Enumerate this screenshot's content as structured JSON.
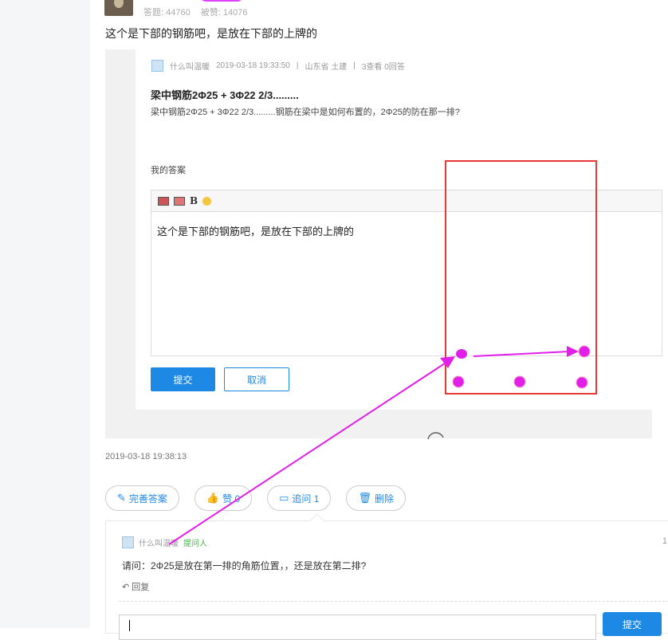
{
  "post": {
    "stats": {
      "answers": "答题: 44760",
      "likes": "被赞: 14076"
    },
    "answer_text": "这个是下部的钢筋吧，是放在下部的上牌的"
  },
  "screenshot": {
    "meta": {
      "user": "什么叫温暖",
      "datetime": "2019-03-18 19:33:50",
      "sep1": "|",
      "location": "山东省 土建",
      "sep2": "|",
      "views": "3查看 0回答"
    },
    "question_title": "梁中钢筋2Φ25 + 3Φ22 2/3.........",
    "question_desc": "梁中钢筋2Φ25 + 3Φ22  2/3.........钢筋在梁中是如何布置的，2Φ25的防在那一排?",
    "my_answer_label": "我的答案",
    "toolbar": {
      "bold": "B"
    },
    "editor_text": "这个是下部的钢筋吧，是放在下部的上牌的",
    "submit_label": "提交",
    "cancel_label": "取消"
  },
  "timestamp": "2019-03-18 19:38:13",
  "actions": {
    "improve": "完善答案",
    "like": "赞 0",
    "followup": "追问 1",
    "delete": "删除"
  },
  "followup": {
    "user": "什么叫温暖",
    "role": "提问人",
    "count": "1",
    "question": "请问：2Φ25是放在第一排的角筋位置，，还是放在第二排?",
    "reply_label": "回复",
    "submit_label": "提交"
  },
  "colors": {
    "accent": "#1e88e5",
    "annotation_magenta": "#e020e8",
    "annotation_red": "#e53935"
  }
}
